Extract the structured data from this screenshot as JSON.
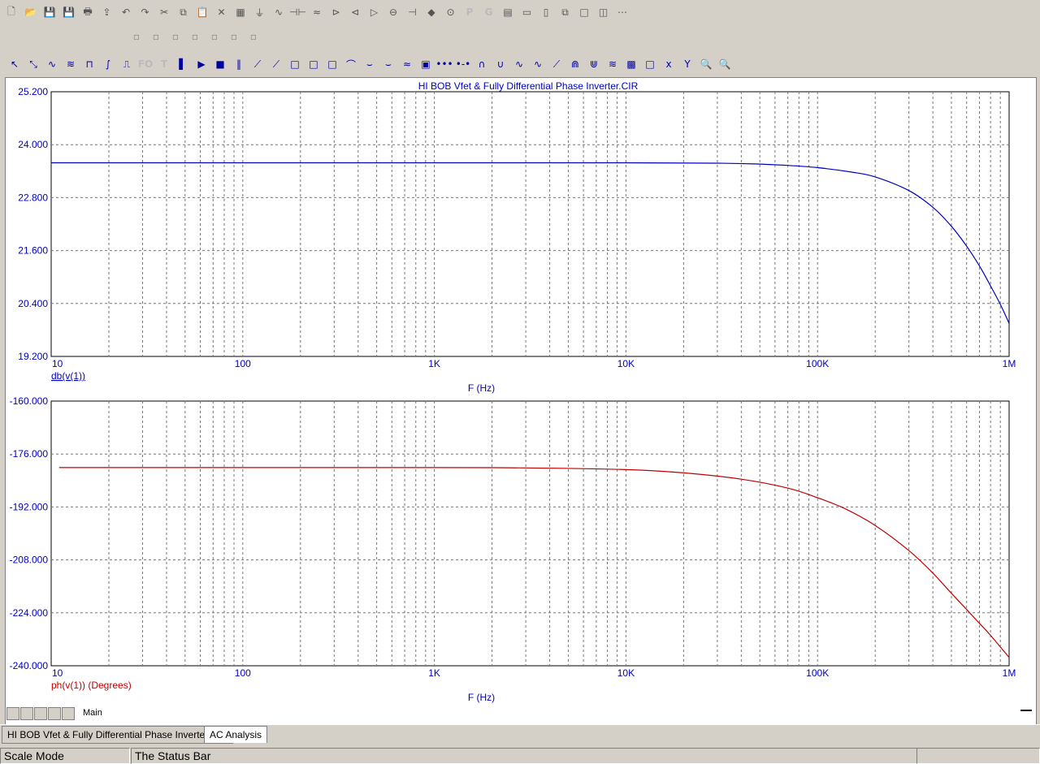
{
  "window": {
    "plot_title": "HI BOB Vfet & Fully Differential Phase Inverter.CIR"
  },
  "toolbar": {
    "row1_icons": [
      "new-file-icon",
      "open-folder-icon",
      "save-icon",
      "save-as-icon",
      "print-icon",
      "export-icon",
      "undo-icon",
      "redo-icon",
      "cut-icon",
      "copy-icon",
      "paste-icon",
      "delete-icon",
      "select-all-icon",
      "ground-icon",
      "resistor-icon",
      "capacitor-icon",
      "inductor-icon",
      "diode-icon",
      "transistor-icon",
      "opamp-icon",
      "source-icon",
      "battery-icon",
      "node-icon",
      "probe-icon",
      "p-icon",
      "g-icon",
      "window-icon",
      "tile-horizontal-icon",
      "tile-vertical-icon",
      "cascade-icon",
      "maximize-icon",
      "split-icon",
      "grid-icon"
    ],
    "row1_glyphs": {
      "p-icon": "P",
      "g-icon": "G"
    },
    "row3_icons": [
      "select-arrow-icon",
      "scale-icon",
      "waveform-icon",
      "wave2-icon",
      "wave3-icon",
      "rise-icon",
      "pulse-icon",
      "fo-icon",
      "text-icon",
      "cursor-icon",
      "play-icon",
      "stop-icon",
      "pause-icon",
      "line-icon",
      "line2-icon",
      "box1-icon",
      "box2-icon",
      "box3-icon",
      "curve1-icon",
      "curve2-icon",
      "curve3-icon",
      "curve4-icon",
      "chart-icon",
      "dots-icon",
      "dots2-icon",
      "peak-icon",
      "valley-icon",
      "peak-valley-icon",
      "wave-icon",
      "slope-icon",
      "highs-icon",
      "lows-icon",
      "both-icon",
      "color-icon",
      "white-box-icon",
      "x-cursor-icon",
      "y-cursor-icon",
      "zoom-in-icon",
      "zoom-out-icon"
    ],
    "row3_glyphs": {
      "fo-icon": "FO",
      "text-icon": "T"
    }
  },
  "chart_data": [
    {
      "type": "line",
      "x_scale": "log",
      "xlabel": "F (Hz)",
      "ylabel": "",
      "xlim": [
        10,
        1000000
      ],
      "ylim": [
        19.2,
        25.2
      ],
      "x_tick_labels": [
        "10",
        "100",
        "1K",
        "10K",
        "100K",
        "1M"
      ],
      "y_tick_labels": [
        "25.200",
        "24.000",
        "22.800",
        "21.600",
        "20.400",
        "19.200"
      ],
      "y_ticks": [
        25.2,
        24.0,
        22.8,
        21.6,
        20.4,
        19.2
      ],
      "grid": true,
      "series": [
        {
          "name": "db(v(1))",
          "color": "#0000c0",
          "x": [
            10,
            100,
            1000,
            10000,
            30000,
            50000,
            70000,
            100000,
            150000,
            200000,
            300000,
            400000,
            500000,
            600000,
            700000,
            800000,
            900000,
            1000000
          ],
          "y": [
            23.59,
            23.59,
            23.59,
            23.59,
            23.58,
            23.56,
            23.53,
            23.48,
            23.38,
            23.27,
            22.96,
            22.58,
            22.15,
            21.7,
            21.25,
            20.8,
            20.38,
            19.95
          ]
        }
      ]
    },
    {
      "type": "line",
      "x_scale": "log",
      "xlabel": "F (Hz)",
      "ylabel": "",
      "xlim": [
        10,
        1000000
      ],
      "ylim": [
        -240,
        -160
      ],
      "x_tick_labels": [
        "10",
        "100",
        "1K",
        "10K",
        "100K",
        "1M"
      ],
      "y_tick_labels": [
        "-160.000",
        "-176.000",
        "-192.000",
        "-208.000",
        "-224.000",
        "-240.000"
      ],
      "y_ticks": [
        -160,
        -176,
        -192,
        -208,
        -224,
        -240
      ],
      "grid": true,
      "series": [
        {
          "name": "ph(v(1)) (Degrees)",
          "color": "#c00000",
          "x": [
            11,
            100,
            1000,
            3000,
            10000,
            20000,
            40000,
            70000,
            100000,
            140000,
            200000,
            300000,
            400000,
            500000,
            600000,
            700000,
            800000,
            1000000
          ],
          "y": [
            -180.1,
            -180.1,
            -180.1,
            -180.2,
            -180.7,
            -181.7,
            -183.6,
            -186.3,
            -189.2,
            -192.6,
            -197.6,
            -205.2,
            -212.0,
            -218.1,
            -223.0,
            -227.2,
            -230.8,
            -237.5
          ]
        }
      ]
    }
  ],
  "bottom": {
    "tab_page_label": "Main",
    "tabs": [
      {
        "label": "HI BOB Vfet & Fully Differential Phase Inverter.CIR",
        "active": false
      },
      {
        "label": "AC Analysis",
        "active": true
      }
    ]
  },
  "status": {
    "mode": "Scale Mode",
    "message": "The Status Bar"
  }
}
